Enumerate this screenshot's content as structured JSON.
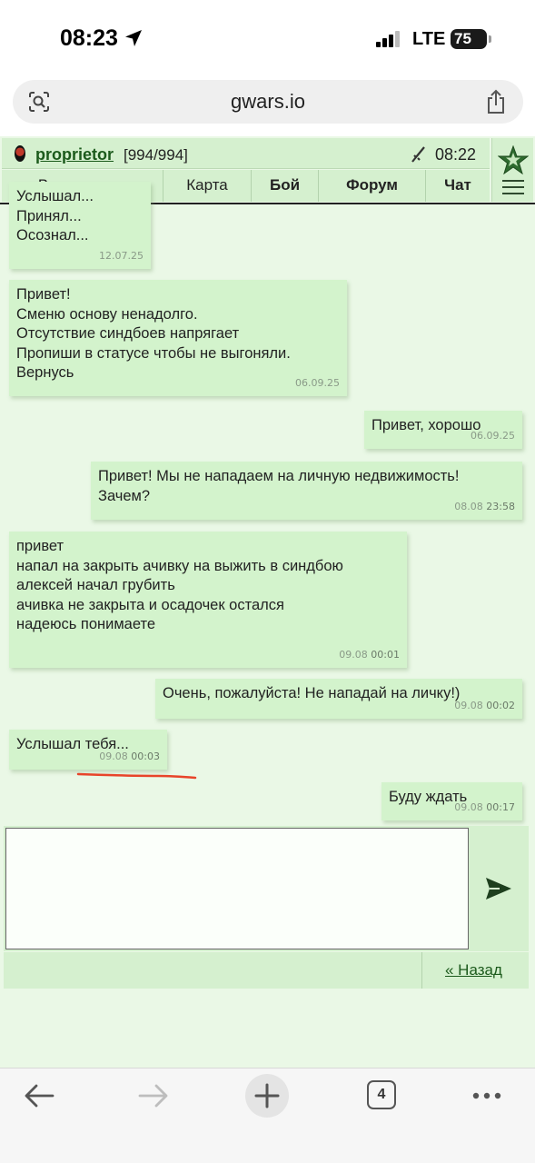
{
  "status_bar": {
    "time": "08:23",
    "network": "LTE",
    "battery": "75"
  },
  "browser": {
    "url": "gwars.io"
  },
  "header": {
    "username": "proprietor",
    "hp": "[994/994]",
    "clock": "08:22"
  },
  "nav": {
    "items": [
      {
        "label": "Вооружение",
        "bold": false
      },
      {
        "label": "Карта",
        "bold": false
      },
      {
        "label": "Бой",
        "bold": true
      },
      {
        "label": "Форум",
        "bold": true
      },
      {
        "label": "Чат",
        "bold": true
      }
    ]
  },
  "messages": [
    {
      "side": "in",
      "text": "Услышал...\nПринял...\nОсознал...",
      "date": "12.07.25",
      "time": ""
    },
    {
      "side": "in",
      "text": "Привет!\nСменю основу ненадолго.\nОтсутствие синдбоев напрягает\nПропиши в статусе чтобы не выгоняли.\nВернусь",
      "date": "06.09.25",
      "time": ""
    },
    {
      "side": "out",
      "text": "Привет, хорошо",
      "date": "06.09.25",
      "time": ""
    },
    {
      "side": "out",
      "text": "Привет! Мы не нападаем на личную недвижимость!\nЗачем?",
      "date": "08.08",
      "time": "23:58"
    },
    {
      "side": "in",
      "text": "привет\nнапал на закрыть ачивку на выжить в синдбою\nалексей начал грубить\nачивка не закрыта и осадочек остался\nнадеюсь понимаете",
      "date": "09.08",
      "time": "00:01"
    },
    {
      "side": "out",
      "text": "Очень, пожалуйста! Не нападай на личку!)",
      "date": "09.08",
      "time": "00:02"
    },
    {
      "side": "in",
      "text": "Услышал тебя...",
      "date": "09.08",
      "time": "00:03"
    },
    {
      "side": "out",
      "text": "Буду ждать",
      "date": "09.08",
      "time": "00:17"
    }
  ],
  "composer": {
    "value": "",
    "back_label": "« Назад"
  },
  "toolbar": {
    "tab_count": "4"
  },
  "colors": {
    "page_bg": "#eaf8e6",
    "bubble": "#d3f3cc",
    "link": "#1c5a1c",
    "annotation": "#e8442a"
  }
}
